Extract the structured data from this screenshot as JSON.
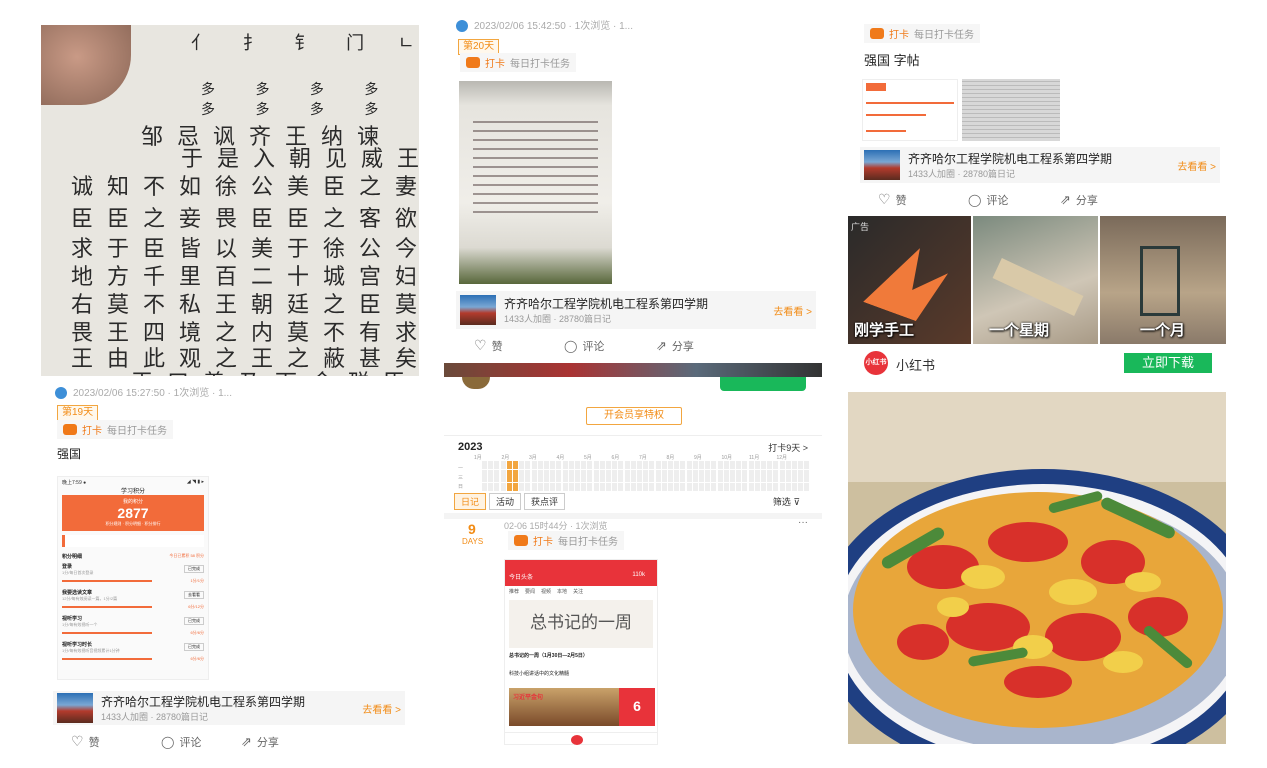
{
  "tile1": {
    "rows": [
      "多 多 多 多 炎 炎 炎",
      "多 多 多 多 炎 炎 炎",
      "邹忌讽齐王纳谏",
      "于是入朝见威王曰臣",
      "诚知不如徐公美臣之妻私",
      "臣臣之妾畏臣臣之客欲有",
      "求于臣皆以美于徐公今齐",
      "地方千里百二十城宫妇左",
      "右莫不私王朝廷之臣莫不",
      "畏王四境之内莫不有求于",
      "王由此观之王之蔽甚矣",
      "王曰善乃下令群臣吏"
    ],
    "header_row": "亻 扌 钅 门 ㄴ 乙 k"
  },
  "tile2": {
    "meta": "2023/02/06 15:42:50 · 1次浏览 · 1...",
    "day_tag": "第20天",
    "checkin_label": "打卡",
    "checkin_task": "每日打卡任务",
    "group_name": "齐齐哈尔工程学院机电工程系第四学期",
    "group_sub": "1433人加圈 · 28780篇日记",
    "group_go": "去看看 >",
    "like": "赞",
    "comment": "评论",
    "share": "分享"
  },
  "tile3": {
    "checkin_label": "打卡",
    "checkin_task": "每日打卡任务",
    "title": "强国 字帖",
    "group_name": "齐齐哈尔工程学院机电工程系第四学期",
    "group_sub": "1433人加圈 · 28780篇日记",
    "group_go": "去看看 >",
    "like": "赞",
    "comment": "评论",
    "share": "分享"
  },
  "tile4": {
    "ad_caption_1": "刚学手工",
    "ad_caption_2": "一个星期",
    "ad_caption_3": "一个月",
    "ad_label": "广告",
    "brand": "小红书",
    "brand_badge": "小红书",
    "download": "立即下载"
  },
  "tile5": {
    "meta": "2023/02/06 15:27:50 · 1次浏览 · 1...",
    "day_tag": "第19天",
    "checkin_label": "打卡",
    "checkin_task": "每日打卡任务",
    "title": "强国",
    "phone_status_left": "晚上7:59 ●",
    "phone_status_right": "◢ ◥ ▮ ▸",
    "phone_title": "学习积分",
    "phone_score_label": "我的积分",
    "phone_score": "2877",
    "phone_score_sub": "积分规则 · 积分明细 · 积分排行",
    "phone_points_title": "积分明细",
    "phone_points_today": "今日已累积 58 积分",
    "phone_items": [
      {
        "name": "登录",
        "desc": "1分/每日首次登录",
        "btn": "已完成",
        "progress": "1分/1分"
      },
      {
        "name": "我要选读文章",
        "desc": "12分/每有效阅读一篇，1分/2篇",
        "btn": "去看看",
        "progress": "6分/12分"
      },
      {
        "name": "视听学习",
        "desc": "1分/每有效视听一个",
        "btn": "已完成",
        "progress": "6分/6分"
      },
      {
        "name": "视听学习时长",
        "desc": "1分/每有效视听音视频累计1分钟",
        "btn": "已完成",
        "progress": "6分/6分"
      }
    ],
    "group_name": "齐齐哈尔工程学院机电工程系第四学期",
    "group_sub": "1433人加圈 · 28780篇日记",
    "group_go": "去看看 >",
    "like": "赞",
    "comment": "评论",
    "share": "分享"
  },
  "tile6": {
    "vip_button": "开会员享特权",
    "year": "2023",
    "streak": "打卡9天 >",
    "months": [
      "1月",
      "2月",
      "3月",
      "4月",
      "5月",
      "6月",
      "7月",
      "8月",
      "9月",
      "10月",
      "11月",
      "12月"
    ],
    "weekday_labels": [
      "一",
      "三",
      "日"
    ],
    "filters": [
      "日记",
      "活动",
      "获点评"
    ],
    "filter_right": "筛选",
    "day_number": "9",
    "day_unit": "DAYS",
    "post_meta": "02-06 15时44分 · 1次浏览",
    "more": "···",
    "checkin_label": "打卡",
    "checkin_task": "每日打卡任务",
    "phone_app": "今日头条",
    "phone_count": "110k",
    "phone_tabs": [
      "推荐",
      "要闻",
      "视频",
      "本地",
      "关注"
    ],
    "phone_heading": "总书记的一周",
    "phone_item_title": "总书记的一周（1月30日—2月5日）",
    "phone_item_2": "科技小组讲话中的文化精髓",
    "phone_banner_title": "习近平金句",
    "phone_banner_num": "6"
  },
  "colors": {
    "accent_orange": "#f28c16",
    "xhs_red": "#e8333a",
    "download_green": "#19b85a",
    "phone_orange": "#f26b3a"
  }
}
